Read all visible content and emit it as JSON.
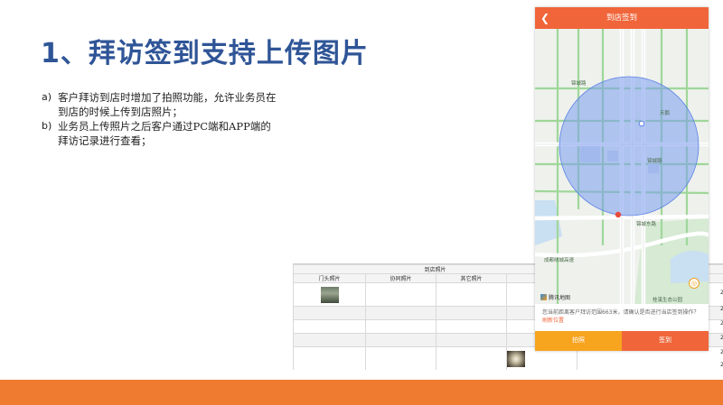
{
  "slide": {
    "title": "1、拜访签到支持上传图片",
    "bullets": [
      {
        "marker": "a)",
        "text": "客户拜访到店时增加了拍照功能，允许业务员在到店的时候上传到店照片；"
      },
      {
        "marker": "b)",
        "text": "业务员上传照片之后客户通过PC端和APP端的拜访记录进行查看；"
      }
    ]
  },
  "table": {
    "group_header": "到店照片",
    "columns": [
      "门头照片",
      "协同照片",
      "其它照片",
      "门"
    ],
    "side_values": [
      "2",
      "2",
      "2",
      "2",
      "2",
      "2"
    ]
  },
  "phone": {
    "header_title": "到店签到",
    "map_labels": {
      "road_east": "天鹅大道北段",
      "road_jinxi": "锦绣路",
      "road_jinxiu_south": "锦城大道",
      "road_jinshan": "锦城东路",
      "road_chengdu_ring": "成都绕城高速",
      "road_tianfu": "天府大道",
      "road_jinhua": "锦华路",
      "road_jiaozi": "交子大道",
      "road_fushi": "府城大道",
      "road_huayang": "锦城大道",
      "park": "桂溪生态公园",
      "building": "环球中心"
    },
    "map_logo": "腾讯地图",
    "tip_text": "您当前距离客户拜访范围663米，请确认是否进行当店签到操作？",
    "refresh_link": "刷新位置",
    "photo_button": "拍照",
    "checkin_button": "签到"
  },
  "colors": {
    "title": "#2f5597",
    "accent_orange": "#f0653a",
    "photo_button": "#f7a41f",
    "footer": "#ee7b30",
    "range_circle": "#7a9cf0"
  }
}
